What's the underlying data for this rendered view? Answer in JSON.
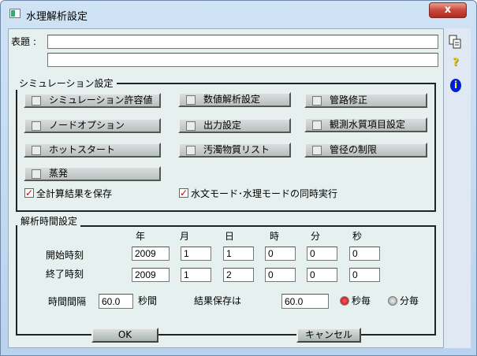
{
  "window": {
    "title": "水理解析設定",
    "close_label": "x"
  },
  "header": {
    "title_label": "表題 :",
    "title_line1": "",
    "title_line2": ""
  },
  "simulation": {
    "group_label": "シミュレーション設定",
    "buttons": [
      "シミュレーション許容値",
      "数値解析設定",
      "管路修正",
      "ノードオプション",
      "出力設定",
      "観測水質項目設定",
      "ホットスタート",
      "汚濁物質リスト",
      "管径の制限",
      "蒸発"
    ],
    "save_all_label": "全計算結果を保存",
    "save_all_checked": true,
    "simultaneous_label": "水文モード･水理モードの同時実行",
    "simultaneous_checked": true
  },
  "time": {
    "group_label": "解析時間設定",
    "headers": [
      "年",
      "月",
      "日",
      "時",
      "分",
      "秒"
    ],
    "start_label": "開始時刻",
    "start": [
      "2009",
      "1",
      "1",
      "0",
      "0",
      "0"
    ],
    "end_label": "終了時刻",
    "end": [
      "2009",
      "1",
      "2",
      "0",
      "0",
      "0"
    ],
    "interval_label": "時間間隔",
    "interval_value": "60.0",
    "interval_unit": "秒間",
    "save_label": "結果保存は",
    "save_value": "60.0",
    "unit_sec_label": "秒毎",
    "unit_min_label": "分毎",
    "selected_unit": "秒毎"
  },
  "footer": {
    "ok_label": "OK",
    "cancel_label": "キャンセル"
  },
  "side_icons": [
    "copy-icon",
    "help-icon",
    "info-icon"
  ],
  "colors": {
    "checkmark": "#cc0000",
    "radio_selected": "#d01010",
    "info": "#0020d0",
    "help": "#e8d000"
  }
}
